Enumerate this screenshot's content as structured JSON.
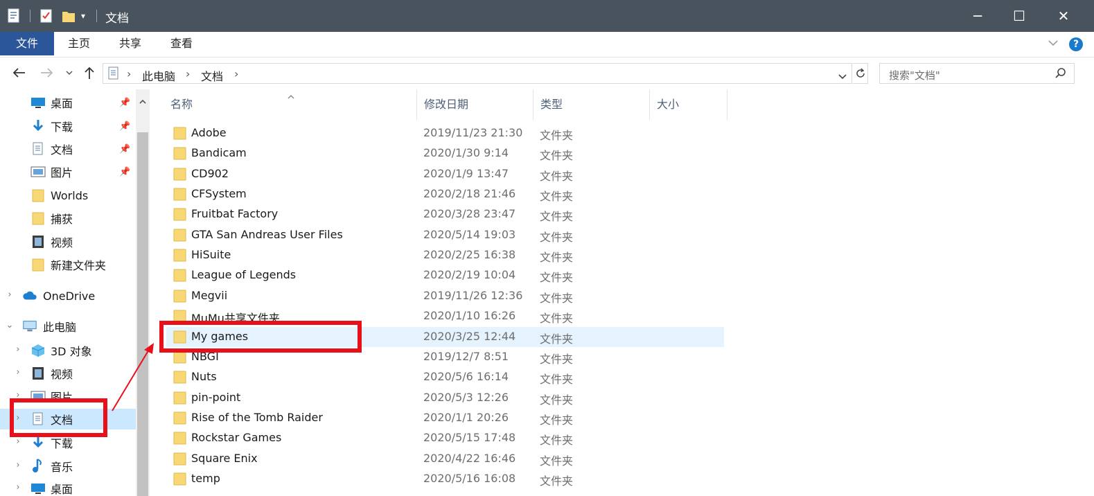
{
  "window": {
    "title": "文档",
    "controls": {
      "minimize": "─",
      "maximize": "☐",
      "close": "✕"
    }
  },
  "ribbon": {
    "tabs": [
      "文件",
      "主页",
      "共享",
      "查看"
    ],
    "expand_icon": "chevron-down-icon",
    "help_icon": "help-icon",
    "help_label": "?"
  },
  "address": {
    "crumbs": [
      "此电脑",
      "文档"
    ],
    "separator": "›",
    "search_placeholder": "搜索\"文档\""
  },
  "navigation": {
    "quick_access": [
      {
        "label": "桌面",
        "icon": "desktop-icon",
        "pinned": true
      },
      {
        "label": "下载",
        "icon": "download-icon",
        "pinned": true
      },
      {
        "label": "文档",
        "icon": "document-icon",
        "pinned": true
      },
      {
        "label": "图片",
        "icon": "pictures-icon",
        "pinned": true
      },
      {
        "label": "Worlds",
        "icon": "folder-icon",
        "pinned": false
      },
      {
        "label": "捕获",
        "icon": "folder-icon",
        "pinned": false
      },
      {
        "label": "视频",
        "icon": "video-icon",
        "pinned": false
      },
      {
        "label": "新建文件夹",
        "icon": "folder-icon",
        "pinned": false
      }
    ],
    "onedrive": {
      "label": "OneDrive",
      "icon": "cloud-icon"
    },
    "this_pc": {
      "label": "此电脑",
      "icon": "computer-icon",
      "children": [
        {
          "label": "3D 对象",
          "icon": "cube-icon"
        },
        {
          "label": "视频",
          "icon": "video-icon"
        },
        {
          "label": "图片",
          "icon": "pictures-icon"
        },
        {
          "label": "文档",
          "icon": "document-icon",
          "selected": true
        },
        {
          "label": "下载",
          "icon": "download-icon"
        },
        {
          "label": "音乐",
          "icon": "music-icon"
        },
        {
          "label": "桌面",
          "icon": "desktop-icon"
        }
      ]
    }
  },
  "columns": {
    "name": "名称",
    "date": "修改日期",
    "type": "类型",
    "size": "大小"
  },
  "files": [
    {
      "name": "Adobe",
      "date": "2019/11/23 21:30",
      "type": "文件夹"
    },
    {
      "name": "Bandicam",
      "date": "2020/1/30 9:14",
      "type": "文件夹"
    },
    {
      "name": "CD902",
      "date": "2020/1/9 13:47",
      "type": "文件夹"
    },
    {
      "name": "CFSystem",
      "date": "2020/2/18 21:46",
      "type": "文件夹"
    },
    {
      "name": "Fruitbat Factory",
      "date": "2020/3/28 23:47",
      "type": "文件夹"
    },
    {
      "name": "GTA San Andreas User Files",
      "date": "2020/5/14 19:03",
      "type": "文件夹"
    },
    {
      "name": "HiSuite",
      "date": "2020/2/25 16:38",
      "type": "文件夹"
    },
    {
      "name": "League of Legends",
      "date": "2020/2/19 10:04",
      "type": "文件夹"
    },
    {
      "name": "Megvii",
      "date": "2019/11/26 12:36",
      "type": "文件夹"
    },
    {
      "name": "MuMu共享文件夹",
      "date": "2020/1/10 16:26",
      "type": "文件夹"
    },
    {
      "name": "My games",
      "date": "2020/3/25 12:44",
      "type": "文件夹",
      "highlighted": true
    },
    {
      "name": "NBGI",
      "date": "2019/12/7 8:51",
      "type": "文件夹"
    },
    {
      "name": "Nuts",
      "date": "2020/5/6 16:14",
      "type": "文件夹"
    },
    {
      "name": "pin-point",
      "date": "2020/5/3 12:26",
      "type": "文件夹"
    },
    {
      "name": "Rise of the Tomb Raider",
      "date": "2020/1/1 20:26",
      "type": "文件夹"
    },
    {
      "name": "Rockstar Games",
      "date": "2020/5/15 17:48",
      "type": "文件夹"
    },
    {
      "name": "Square Enix",
      "date": "2020/4/22 16:46",
      "type": "文件夹"
    },
    {
      "name": "temp",
      "date": "2020/5/16 16:08",
      "type": "文件夹"
    }
  ],
  "colors": {
    "titlebar": "#48535d",
    "file_tab": "#2b579a",
    "selection": "#cce8ff",
    "hover_row": "#e5f3ff",
    "annotation": "#e8101a",
    "folder": "#f8d775"
  }
}
